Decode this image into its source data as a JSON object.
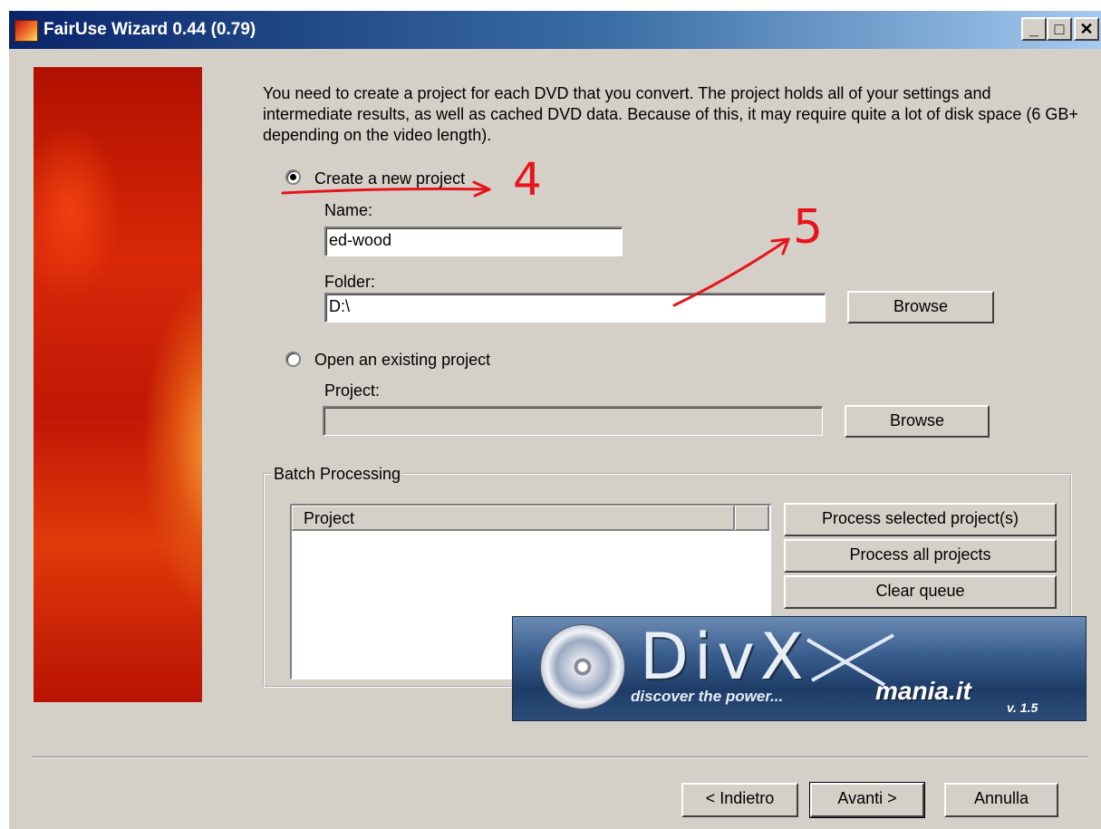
{
  "window": {
    "title": "FairUse Wizard 0.44 (0.79)",
    "controls": {
      "minimize": "_",
      "maximize": "□",
      "close": "✕"
    }
  },
  "description": "You need to create a project for each DVD that you convert. The project holds all of your settings and intermediate results, as well as cached DVD data. Because of this, it may require quite a lot of disk space (6 GB+ depending on the video length).",
  "new_project": {
    "option_label": "Create a new project",
    "selected": true,
    "name_label": "Name:",
    "name_value": "ed-wood",
    "folder_label": "Folder:",
    "folder_value": "D:\\",
    "browse_label": "Browse"
  },
  "existing_project": {
    "option_label": "Open an existing project",
    "selected": false,
    "project_label": "Project:",
    "project_value": "",
    "browse_label": "Browse"
  },
  "batch": {
    "group_label": "Batch Processing",
    "column_header": "Project",
    "items": [],
    "buttons": {
      "process_selected": "Process selected project(s)",
      "process_all": "Process all projects",
      "clear_queue": "Clear queue"
    }
  },
  "banner": {
    "tagline": "discover the power...",
    "brand": "mania.it",
    "version": "v. 1.5",
    "logo_text": "DivX"
  },
  "annotations": {
    "mark_4": "4",
    "mark_5": "5",
    "color": "#e8141c"
  },
  "footer": {
    "back": "< Indietro",
    "next": "Avanti >",
    "cancel": "Annulla"
  }
}
